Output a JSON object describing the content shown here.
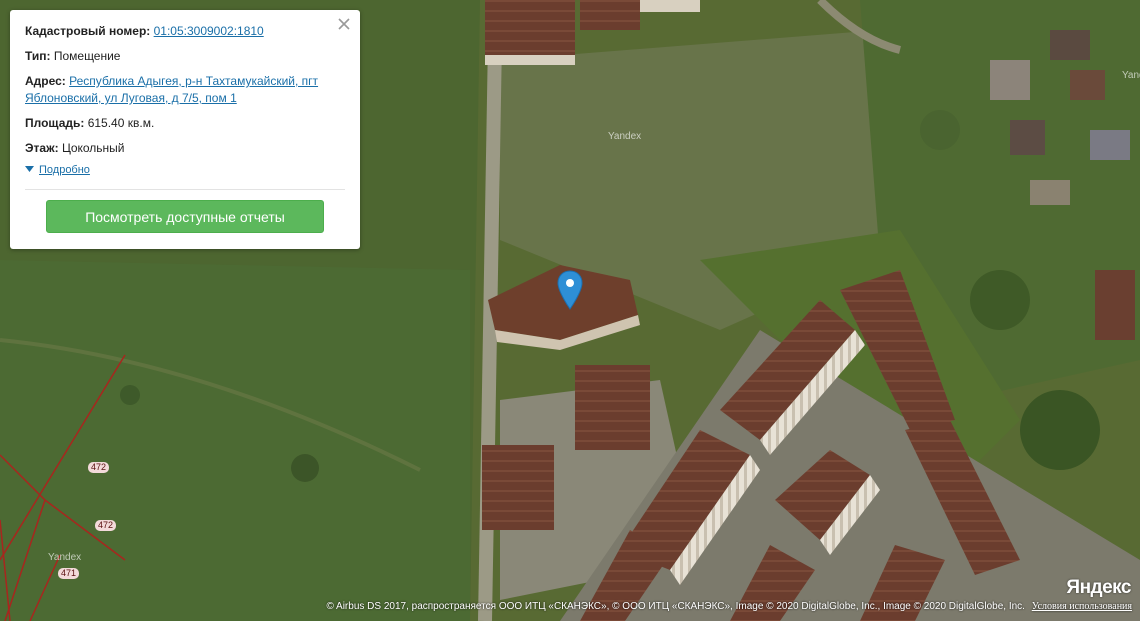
{
  "map": {
    "watermark": "Yandex",
    "logo": "Яндекс",
    "attribution": "© Airbus DS 2017, распространяется ООО ИТЦ «СКАНЭКС», © ООО ИТЦ «СКАНЭКС», Image © 2020 DigitalGlobe, Inc., Image © 2020 DigitalGlobe, Inc.",
    "terms_link": "Условия использования",
    "plot_labels": [
      "472",
      "472",
      "471"
    ],
    "marker_icon": "location-pin-icon",
    "marker_color": "#2e8fd6"
  },
  "card": {
    "cadastral_label": "Кадастровый номер:",
    "cadastral_value": "01:05:3009002:1810",
    "type_label": "Тип:",
    "type_value": "Помещение",
    "address_label": "Адрес:",
    "address_value": "Республика Адыгея, р-н Тахтамукайский, пгт Яблоновский, ул Луговая, д 7/5, пом 1",
    "area_label": "Площадь:",
    "area_value": "615.40 кв.м.",
    "floor_label": "Этаж:",
    "floor_value": "Цокольный",
    "details_link": "Подробно",
    "button_label": "Посмотреть доступные отчеты",
    "button_color": "#5cb85c",
    "link_color": "#1a6fa8",
    "close_icon": "close-icon"
  }
}
